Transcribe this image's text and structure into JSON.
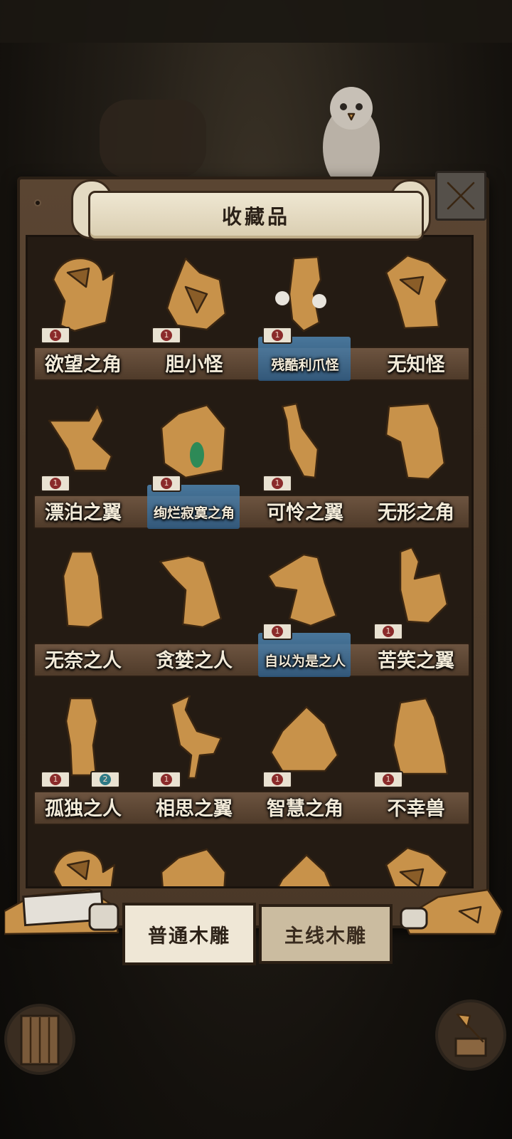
{
  "title": "收藏品",
  "tabs": {
    "normal": "普通木雕",
    "main": "主线木雕"
  },
  "shelves": [
    [
      {
        "name": "欲望之角",
        "badges": [
          "1"
        ],
        "highlight": false,
        "figure": "lion"
      },
      {
        "name": "胆小怪",
        "badges": [
          "1"
        ],
        "highlight": false,
        "figure": "bird-hood"
      },
      {
        "name": "残酷利爪怪",
        "badges": [
          "1"
        ],
        "highlight": true,
        "figure": "claw"
      },
      {
        "name": "无知怪",
        "badges": [],
        "highlight": false,
        "figure": "jester"
      }
    ],
    [
      {
        "name": "漂泊之翼",
        "badges": [
          "1"
        ],
        "highlight": false,
        "figure": "pelican"
      },
      {
        "name": "绚烂寂寞之角",
        "badges": [
          "1"
        ],
        "highlight": true,
        "figure": "rhino"
      },
      {
        "name": "可怜之翼",
        "badges": [
          "1"
        ],
        "highlight": false,
        "figure": "heron"
      },
      {
        "name": "无形之角",
        "badges": [],
        "highlight": false,
        "figure": "elephant"
      }
    ],
    [
      {
        "name": "无奈之人",
        "badges": [],
        "highlight": false,
        "figure": "old-man"
      },
      {
        "name": "贪婪之人",
        "badges": [],
        "highlight": false,
        "figure": "long-nose"
      },
      {
        "name": "自以为是之人",
        "badges": [
          "1"
        ],
        "highlight": true,
        "figure": "pointing"
      },
      {
        "name": "苦笑之翼",
        "badges": [
          "1"
        ],
        "highlight": false,
        "figure": "rooster"
      }
    ],
    [
      {
        "name": "孤独之人",
        "badges": [
          "1",
          "2"
        ],
        "highlight": false,
        "figure": "girl"
      },
      {
        "name": "相思之翼",
        "badges": [
          "1"
        ],
        "highlight": false,
        "figure": "crane"
      },
      {
        "name": "智慧之角",
        "badges": [
          "1"
        ],
        "highlight": false,
        "figure": "turtle"
      },
      {
        "name": "不幸兽",
        "badges": [
          "1"
        ],
        "highlight": false,
        "figure": "capybara"
      }
    ]
  ],
  "colors": {
    "wood": "#c8924a",
    "wood_dark": "#8a5d28",
    "highlight": "#3c6f99",
    "badge_red": "#8a2b2b",
    "badge_teal": "#2f7a86"
  },
  "icons": {
    "close": "close-icon",
    "door": "door-icon",
    "axe": "axe-icon"
  }
}
